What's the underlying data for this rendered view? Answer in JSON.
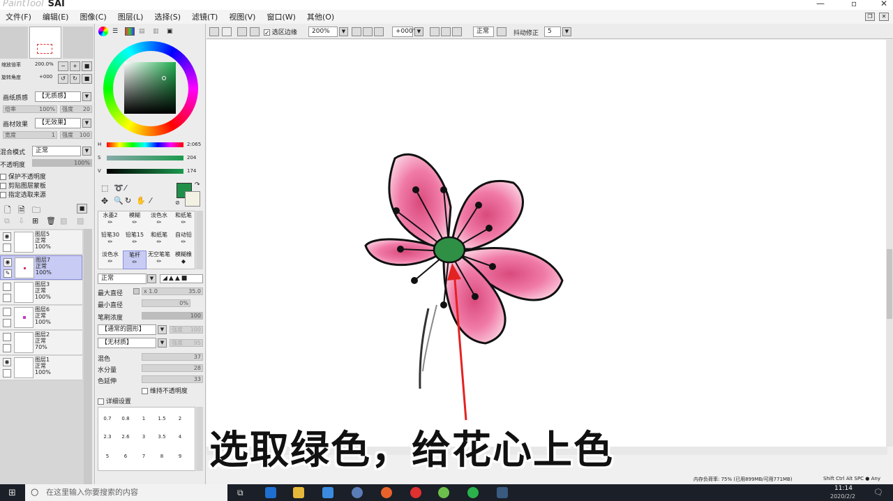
{
  "app": {
    "title": "SAI",
    "subtitle": "PaintTool"
  },
  "menu": [
    "文件(F)",
    "编辑(E)",
    "图像(C)",
    "图层(L)",
    "选择(S)",
    "滤镜(T)",
    "视图(V)",
    "窗口(W)",
    "其他(O)"
  ],
  "navigator": {
    "zoom_label": "缩放倍率",
    "zoom_value": "200.0%",
    "rotate_label": "旋转角度",
    "rotate_value": "+000"
  },
  "layer_props": {
    "paper_label": "画纸质感",
    "paper_value": "【无质感】",
    "paper_sub1": "倍率",
    "paper_sub1_val": "100%",
    "paper_sub2": "强度",
    "paper_sub2_val": "20",
    "material_label": "画材效果",
    "material_value": "【无效果】",
    "material_sub1": "宽度",
    "material_sub1_val": "1",
    "material_sub2": "强度",
    "material_sub2_val": "100",
    "blend_label": "混合模式",
    "blend_value": "正常",
    "opacity_label": "不透明度",
    "opacity_value": "100%",
    "check1": "保护不透明度",
    "check2": "剪贴图层蒙板",
    "check3": "指定选取来源"
  },
  "layers": [
    {
      "name": "图层5",
      "mode": "正常",
      "opacity": "100%",
      "selected": false
    },
    {
      "name": "图层7",
      "mode": "正常",
      "opacity": "100%",
      "selected": true
    },
    {
      "name": "图层3",
      "mode": "正常",
      "opacity": "100%",
      "selected": false
    },
    {
      "name": "图层6",
      "mode": "正常",
      "opacity": "100%",
      "selected": false
    },
    {
      "name": "图层2",
      "mode": "正常",
      "opacity": "70%",
      "selected": false
    },
    {
      "name": "图层1",
      "mode": "正常",
      "opacity": "100%",
      "selected": false
    }
  ],
  "color": {
    "h_label": "H",
    "h_value": "2:065",
    "s_label": "S",
    "s_value": "204",
    "v_label": "V",
    "v_value": "174",
    "primary": "#1f8f4a"
  },
  "brushes": [
    [
      "水墨2",
      "模糊",
      "淡色水",
      "和纸笔"
    ],
    [
      "铅笔30",
      "铅笔15",
      "和纸笔",
      "自动铅"
    ],
    [
      "淡色水",
      "笔杆",
      "无空笔笔",
      "模糊橡"
    ]
  ],
  "brush_settings": {
    "mode_value": "正常",
    "max_size_label": "最大直径",
    "max_size_mult": "x 1.0",
    "max_size_value": "35.0",
    "min_size_label": "最小直径",
    "min_size_value": "0%",
    "density_label": "笔刷浓度",
    "density_value": "100",
    "shape_value": "【通常的圆形】",
    "shape_sub": "强度",
    "shape_sub_val": "100",
    "texture_value": "【无材质】",
    "texture_sub": "强度",
    "texture_sub_val": "95",
    "blend_label": "混色",
    "blend_value": "37",
    "water_label": "水分量",
    "water_value": "28",
    "extend_label": "色延伸",
    "extend_value": "33",
    "keep_opacity": "维持不透明度",
    "detail": "详细设置"
  },
  "brush_sizes": [
    [
      "0.7",
      "0.8",
      "1",
      "1.5",
      "2"
    ],
    [
      "2.3",
      "2.6",
      "3",
      "3.5",
      "4"
    ],
    [
      "5",
      "6",
      "7",
      "8",
      "9"
    ]
  ],
  "toolbar": {
    "sel_edge": "选区边缘",
    "zoom": "200%",
    "angle": "+000°",
    "mode": "正常",
    "stabilizer_label": "抖动修正",
    "stabilizer_value": "5"
  },
  "caption": "选取绿色，给花心上色",
  "status": "内存负荷率: 75% (已用899MB/可用771MB)",
  "status_keys": "Shift Ctrl Alt SPC ● Any",
  "taskbar": {
    "search_placeholder": "在这里输入你要搜索的内容",
    "time": "11:14",
    "date": "2020/2/2"
  }
}
